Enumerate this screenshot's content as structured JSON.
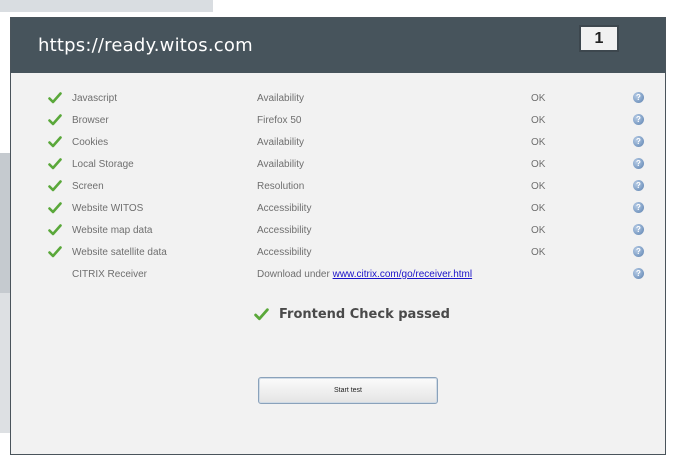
{
  "window": {
    "url": "https://ready.witos.com",
    "badge": "1"
  },
  "colors": {
    "titlebar": "#47545c",
    "check": "#5aa83a",
    "link": "#1a12c8"
  },
  "checks": [
    {
      "name": "Javascript",
      "type": "Availability",
      "status": "OK",
      "passed": true
    },
    {
      "name": "Browser",
      "type": "Firefox 50",
      "status": "OK",
      "passed": true
    },
    {
      "name": "Cookies",
      "type": "Availability",
      "status": "OK",
      "passed": true
    },
    {
      "name": "Local Storage",
      "type": "Availability",
      "status": "OK",
      "passed": true
    },
    {
      "name": "Screen",
      "type": "Resolution",
      "status": "OK",
      "passed": true
    },
    {
      "name": "Website WITOS",
      "type": "Accessibility",
      "status": "OK",
      "passed": true
    },
    {
      "name": "Website map data",
      "type": "Accessibility",
      "status": "OK",
      "passed": true
    },
    {
      "name": "Website satellite data",
      "type": "Accessibility",
      "status": "OK",
      "passed": true
    }
  ],
  "citrix": {
    "name": "CITRIX Receiver",
    "text": "Download under",
    "link": "www.citrix.com/go/receiver.html"
  },
  "help_icon": "help-icon",
  "result": {
    "text": "Frontend Check passed"
  },
  "start_button": {
    "label": "Start test"
  }
}
